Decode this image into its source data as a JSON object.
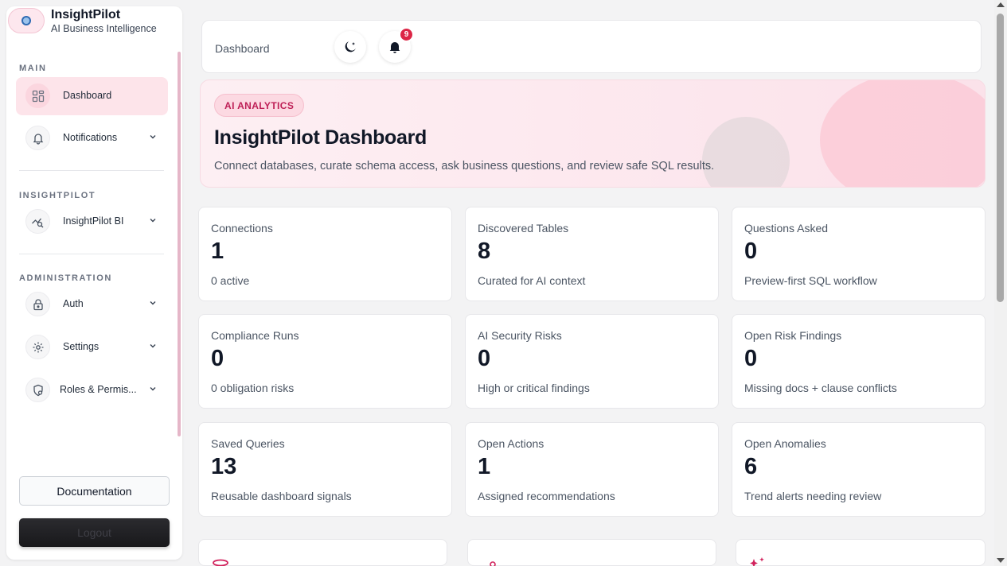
{
  "brand": {
    "name": "InsightPilot",
    "subtitle": "AI Business Intelligence"
  },
  "sidebar": {
    "sections": [
      {
        "label": "MAIN"
      },
      {
        "label": "INSIGHTPILOT"
      },
      {
        "label": "ADMINISTRATION"
      }
    ],
    "items": [
      {
        "label": "Dashboard",
        "icon": "grid-icon",
        "active": true
      },
      {
        "label": "Notifications",
        "icon": "bell-icon"
      },
      {
        "label": "InsightPilot BI",
        "icon": "chart-search-icon"
      },
      {
        "label": "Auth",
        "icon": "lock-icon"
      },
      {
        "label": "Settings",
        "icon": "gear-icon"
      },
      {
        "label": "Roles & Permis...",
        "icon": "shield-user-icon"
      }
    ],
    "documentation_label": "Documentation",
    "logout_label": "Logout"
  },
  "topbar": {
    "breadcrumb": "Dashboard",
    "notification_count": "9"
  },
  "hero": {
    "tag": "AI ANALYTICS",
    "title": "InsightPilot Dashboard",
    "subtitle": "Connect databases, curate schema access, ask business questions, and review safe SQL results."
  },
  "stats": [
    {
      "label": "Connections",
      "value": "1",
      "note": "0 active"
    },
    {
      "label": "Discovered Tables",
      "value": "8",
      "note": "Curated for AI context"
    },
    {
      "label": "Questions Asked",
      "value": "0",
      "note": "Preview-first SQL workflow"
    },
    {
      "label": "Compliance Runs",
      "value": "0",
      "note": "0 obligation risks"
    },
    {
      "label": "AI Security Risks",
      "value": "0",
      "note": "High or critical findings"
    },
    {
      "label": "Open Risk Findings",
      "value": "0",
      "note": "Missing docs + clause conflicts"
    },
    {
      "label": "Saved Queries",
      "value": "13",
      "note": "Reusable dashboard signals"
    },
    {
      "label": "Open Actions",
      "value": "1",
      "note": "Assigned recommendations"
    },
    {
      "label": "Open Anomalies",
      "value": "6",
      "note": "Trend alerts needing review"
    }
  ],
  "colors": {
    "accent": "#dc2646",
    "accent_soft": "#fde4ea",
    "tag_text": "#be1f56"
  }
}
